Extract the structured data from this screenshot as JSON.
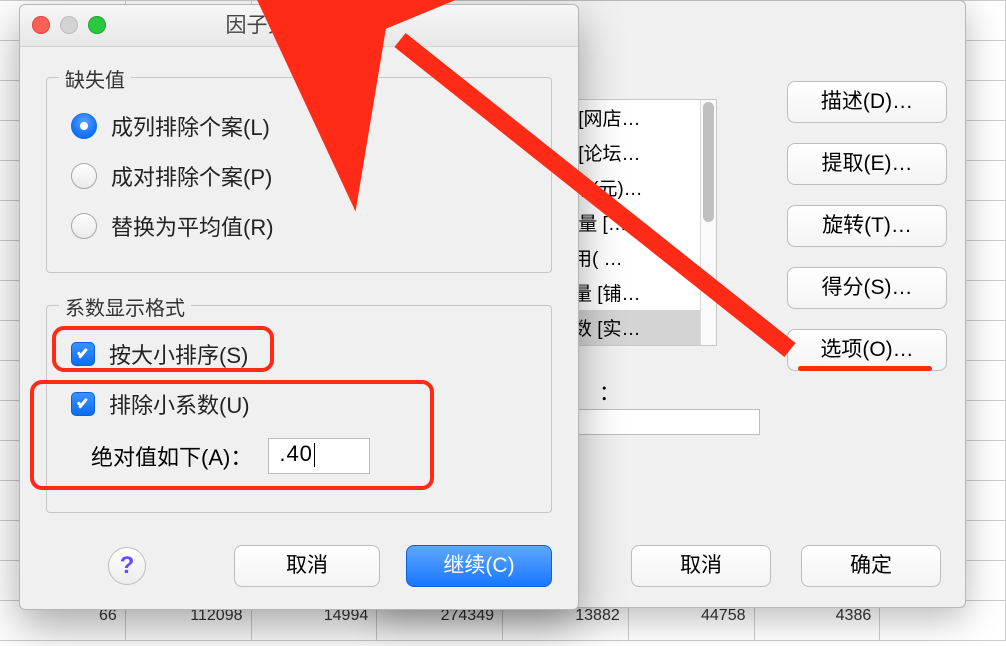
{
  "sheet_row_last": [
    "66",
    "112098",
    "14994",
    "274349",
    "13882",
    "44758",
    "4386",
    ""
  ],
  "back_dialog": {
    "list_items": [
      "量 [网店…",
      "量 [论坛…",
      "费用(元)…",
      "引    量 […",
      "费用(     …",
      "货量 [铺…",
      "客数 [实…"
    ],
    "colon": "：",
    "side_buttons": {
      "describe": "描述(D)…",
      "extract": "提取(E)…",
      "rotate": "旋转(T)…",
      "score": "得分(S)…",
      "options": "选项(O)…"
    },
    "cancel": "取消",
    "ok": "确定"
  },
  "front_dialog": {
    "title": "因子分析：选项",
    "group_missing": {
      "legend": "缺失值",
      "opt_listwise": "成列排除个案(L)",
      "opt_pairwise": "成对排除个案(P)",
      "opt_meanrepl": "替换为平均值(R)"
    },
    "group_coef": {
      "legend": "系数显示格式",
      "chk_sort": "按大小排序(S)",
      "chk_suppress": "排除小系数(U)",
      "abs_label": "绝对值如下(A)：",
      "abs_value": ".40"
    },
    "help": "?",
    "cancel": "取消",
    "continue": "继续(C)"
  }
}
